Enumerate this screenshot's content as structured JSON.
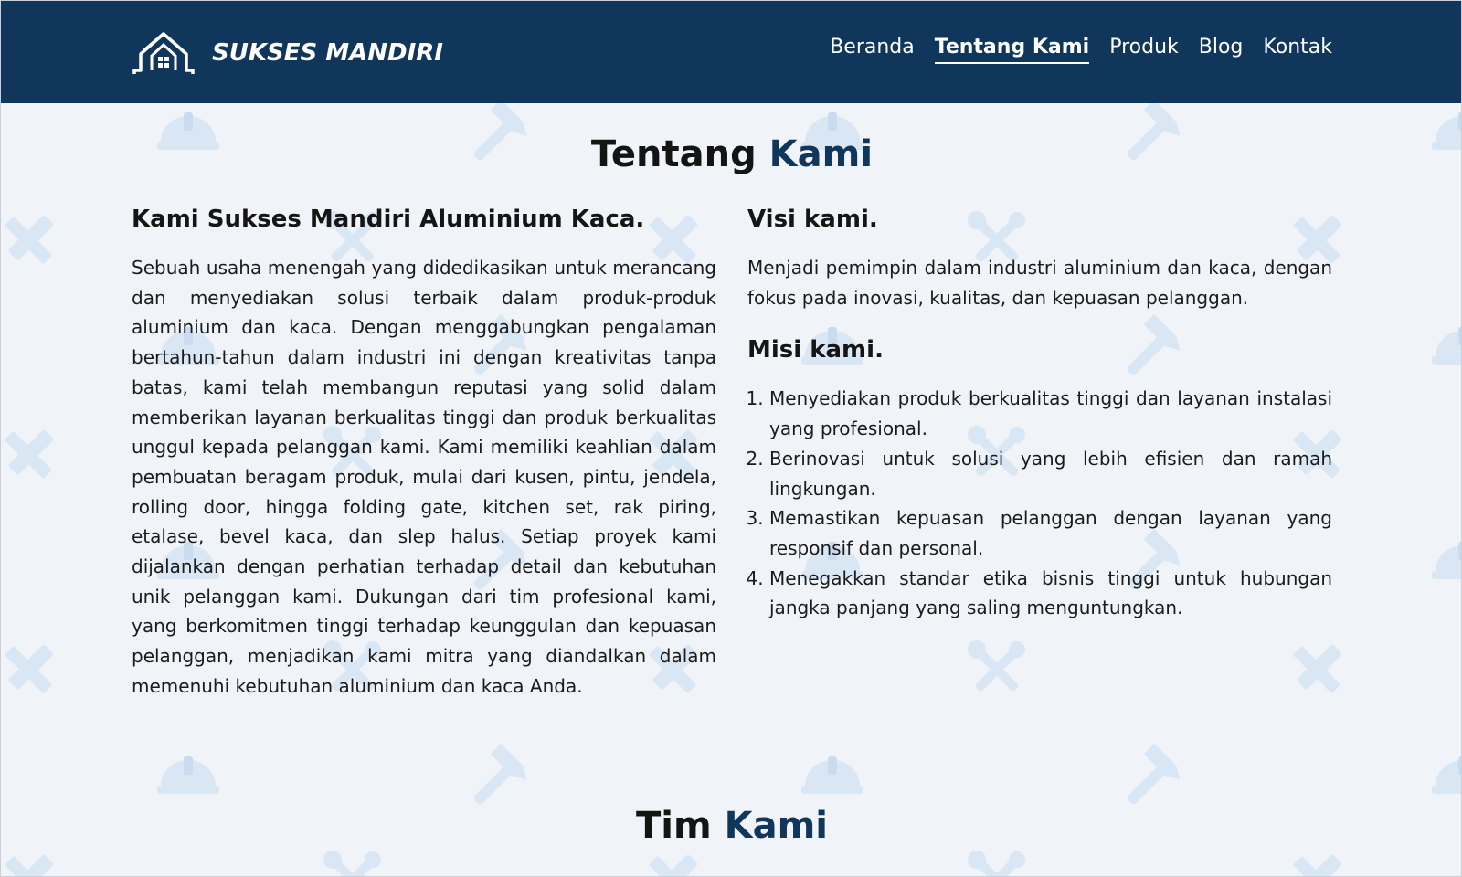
{
  "brand": {
    "name": "SUKSES MANDIRI",
    "logo_icon": "house-logo-icon"
  },
  "nav": {
    "items": [
      {
        "label": "Beranda",
        "active": false
      },
      {
        "label": "Tentang Kami",
        "active": true
      },
      {
        "label": "Produk",
        "active": false
      },
      {
        "label": "Blog",
        "active": false
      },
      {
        "label": "Kontak",
        "active": false
      }
    ]
  },
  "about": {
    "title_main": "Tentang",
    "title_accent": "Kami",
    "company_heading": "Kami Sukses Mandiri Aluminium Kaca.",
    "company_text": "Sebuah usaha menengah yang didedikasikan untuk merancang dan menyediakan solusi terbaik dalam produk-produk aluminium dan kaca. Dengan menggabungkan pengalaman bertahun-tahun dalam industri ini dengan kreativitas tanpa batas, kami telah membangun reputasi yang solid dalam memberikan layanan berkualitas tinggi dan produk berkualitas unggul kepada pelanggan kami. Kami memiliki keahlian dalam pembuatan beragam produk, mulai dari kusen, pintu, jendela, rolling door, hingga folding gate, kitchen set, rak piring, etalase, bevel kaca, dan slep halus. Setiap proyek kami dijalankan dengan perhatian terhadap detail dan kebutuhan unik pelanggan kami. Dukungan dari tim profesional kami, yang berkomitmen tinggi terhadap keunggulan dan kepuasan pelanggan, menjadikan kami mitra yang diandalkan dalam memenuhi kebutuhan aluminium dan kaca Anda.",
    "vision_heading": "Visi kami.",
    "vision_text": "Menjadi pemimpin dalam industri aluminium dan kaca, dengan fokus pada inovasi, kualitas, dan kepuasan pelanggan.",
    "mission_heading": "Misi kami.",
    "mission_items": [
      "Menyediakan produk berkualitas tinggi dan layanan instalasi yang profesional.",
      "Berinovasi untuk solusi yang lebih efisien dan ramah lingkungan.",
      "Memastikan kepuasan pelanggan dengan layanan yang responsif dan personal.",
      "Menegakkan standar etika bisnis tinggi untuk hubungan jangka panjang yang saling menguntungkan."
    ]
  },
  "team": {
    "title_main": "Tim",
    "title_accent": "Kami"
  },
  "colors": {
    "navbar": "#11365c",
    "accent": "#11365c",
    "background": "#f0f3f8",
    "pattern": "#d6e4f3"
  },
  "background_icons": [
    "helmet-icon",
    "hammer-icon",
    "tools-icon",
    "pencil-ruler-icon"
  ]
}
